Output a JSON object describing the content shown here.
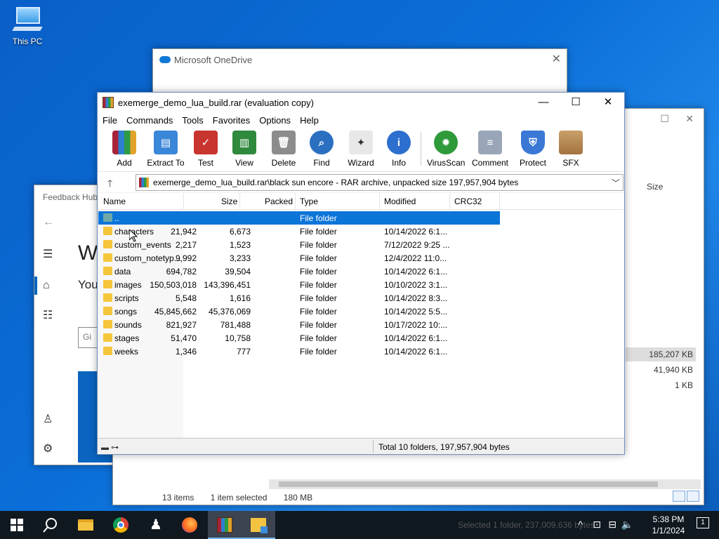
{
  "desktop": {
    "icon_label": "This PC"
  },
  "feedback": {
    "title": "Feedback Hub",
    "heading": "W",
    "you": "You",
    "input_placeholder": "Gi"
  },
  "onedrive": {
    "title": "Microsoft OneDrive"
  },
  "explorer": {
    "col_size": "Size",
    "sizes": [
      "185,207 KB",
      "41,940 KB",
      "1 KB"
    ],
    "status_items": "13 items",
    "status_selected": "1 item selected",
    "status_size": "180 MB"
  },
  "winrar": {
    "title": "exemerge_demo_lua_build.rar (evaluation copy)",
    "menu": [
      "File",
      "Commands",
      "Tools",
      "Favorites",
      "Options",
      "Help"
    ],
    "toolbar": [
      "Add",
      "Extract To",
      "Test",
      "View",
      "Delete",
      "Find",
      "Wizard",
      "Info",
      "VirusScan",
      "Comment",
      "Protect",
      "SFX"
    ],
    "address": "exemerge_demo_lua_build.rar\\black sun encore - RAR archive, unpacked size 197,957,904 bytes",
    "columns": [
      "Name",
      "Size",
      "Packed",
      "Type",
      "Modified",
      "CRC32"
    ],
    "rows": [
      {
        "name": "..",
        "size": "",
        "packed": "",
        "type": "File folder",
        "modified": ""
      },
      {
        "name": "characters",
        "size": "21,942",
        "packed": "6,673",
        "type": "File folder",
        "modified": "10/14/2022 6:1..."
      },
      {
        "name": "custom_events",
        "size": "2,217",
        "packed": "1,523",
        "type": "File folder",
        "modified": "7/12/2022 9:25 ..."
      },
      {
        "name": "custom_notetyp...",
        "size": "9,992",
        "packed": "3,233",
        "type": "File folder",
        "modified": "12/4/2022 11:0..."
      },
      {
        "name": "data",
        "size": "694,782",
        "packed": "39,504",
        "type": "File folder",
        "modified": "10/14/2022 6:1..."
      },
      {
        "name": "images",
        "size": "150,503,018",
        "packed": "143,396,451",
        "type": "File folder",
        "modified": "10/10/2022 3:1..."
      },
      {
        "name": "scripts",
        "size": "5,548",
        "packed": "1,616",
        "type": "File folder",
        "modified": "10/14/2022 8:3..."
      },
      {
        "name": "songs",
        "size": "45,845,662",
        "packed": "45,376,069",
        "type": "File folder",
        "modified": "10/14/2022 5:5..."
      },
      {
        "name": "sounds",
        "size": "821,927",
        "packed": "781,488",
        "type": "File folder",
        "modified": "10/17/2022 10:..."
      },
      {
        "name": "stages",
        "size": "51,470",
        "packed": "10,758",
        "type": "File folder",
        "modified": "10/14/2022 6:1..."
      },
      {
        "name": "weeks",
        "size": "1,346",
        "packed": "777",
        "type": "File folder",
        "modified": "10/14/2022 6:1..."
      }
    ],
    "status_total": "Total 10 folders, 197,957,904 bytes"
  },
  "taskbar": {
    "time": "5:38 PM",
    "date": "1/1/2024",
    "ghost_text": "Selected 1 folder, 237,009,636 bytes",
    "notification_count": "1"
  }
}
